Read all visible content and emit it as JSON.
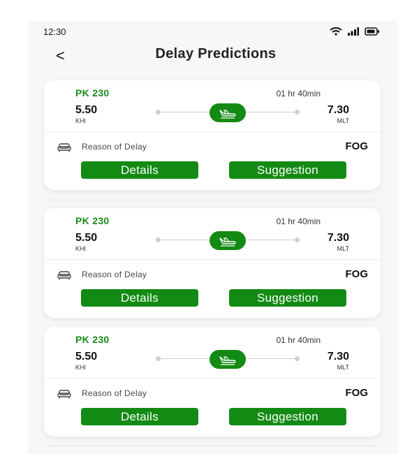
{
  "status_bar": {
    "time": "12:30",
    "icons": [
      "wifi-icon",
      "signal-icon",
      "battery-icon"
    ]
  },
  "header": {
    "back_icon": "chevron-left-icon",
    "back_glyph": "<",
    "title": "Delay Predictions"
  },
  "colors": {
    "brand_green": "#138a13",
    "flight_green": "#1a8a1a",
    "background": "#f7f7f7",
    "card": "#ffffff"
  },
  "cards": [
    {
      "flight_no": "PK 230",
      "duration": "01 hr 40min",
      "departure": {
        "time": "5.50",
        "code": "KHI"
      },
      "arrival": {
        "time": "7.30",
        "code": "MLT"
      },
      "plane_icon": "airplane-landing-icon",
      "reason_icon": "sofa-icon",
      "reason_label": "Reason of Delay",
      "reason_value": "FOG",
      "details_label": "Details",
      "suggestion_label": "Suggestion"
    },
    {
      "flight_no": "PK 230",
      "duration": "01 hr 40min",
      "departure": {
        "time": "5.50",
        "code": "KHI"
      },
      "arrival": {
        "time": "7.30",
        "code": "MLT"
      },
      "plane_icon": "airplane-landing-icon",
      "reason_icon": "sofa-icon",
      "reason_label": "Reason of Delay",
      "reason_value": "FOG",
      "details_label": "Details",
      "suggestion_label": "Suggestion"
    },
    {
      "flight_no": "PK 230",
      "duration": "01 hr 40min",
      "departure": {
        "time": "5.50",
        "code": "KHI"
      },
      "arrival": {
        "time": "7.30",
        "code": "MLT"
      },
      "plane_icon": "airplane-landing-icon",
      "reason_icon": "sofa-icon",
      "reason_label": "Reason of Delay",
      "reason_value": "FOG",
      "details_label": "Details",
      "suggestion_label": "Suggestion"
    }
  ]
}
